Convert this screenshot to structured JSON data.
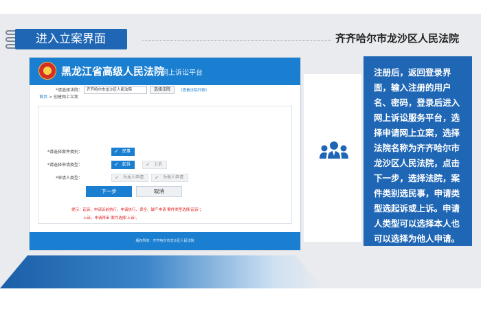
{
  "header": {
    "section_title": "进入立案界面",
    "court_name": "齐齐哈尔市龙沙区人民法院"
  },
  "portal": {
    "title": "黑龙江省高级人民法院",
    "subtitle": "网上诉讼平台",
    "breadcrumb_home": "首页",
    "breadcrumb_current": "创建网上立案",
    "form": {
      "court_label": "*请选择法院：",
      "court_value": "齐齐哈尔市龙沙区人民法院",
      "select_court_button": "选择法院",
      "court_link": "《查看法院列表》",
      "case_type_label": "*请选择案件类别：",
      "case_type_option": "民事",
      "apply_type_label": "*请选择申请类型：",
      "apply_type_options": [
        "起诉",
        "上诉"
      ],
      "applicant_type_label": "*申请人类型：",
      "applicant_type_options": [
        "为本人申请",
        "为他人申请"
      ],
      "next_button": "下一步",
      "cancel_button": "取消",
      "tip_line1": "提示：起诉、申请诉前执行、申请执行、保全、破产申请 案件类型选择'起诉'；",
      "tip_line2": "上诉、申请再审 案件选择'上诉'。"
    },
    "footer": "版权所有：齐齐哈尔市龙沙区人民法院"
  },
  "icon": "people-group-icon",
  "description": "注册后，返回登录界面，输入注册的用户名、密码，登录后进入网上诉讼服务平台，选择申请网上立案，选择法院名称为齐齐哈尔市龙沙区人民法院，点击下一步，选择法院，案件类别选民事，申请类型选起诉或上诉。申请人类型可以选择本人也可以选择为他人申请。",
  "colors": {
    "accent": "#1f66b5",
    "portal_blue": "#1b7fd1",
    "tip_red": "#e02424"
  }
}
